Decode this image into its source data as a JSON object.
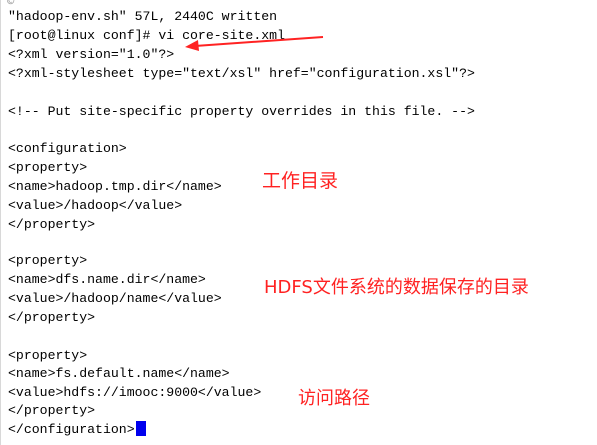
{
  "terminal": {
    "top_mark": "©",
    "lines": [
      "\"hadoop-env.sh\" 57L, 2440C written",
      "[root@linux conf]# vi core-site.xml",
      "<?xml version=\"1.0\"?>",
      "<?xml-stylesheet type=\"text/xsl\" href=\"configuration.xsl\"?>",
      "",
      "<!-- Put site-specific property overrides in this file. -->",
      "",
      "<configuration>",
      "<property>",
      "<name>hadoop.tmp.dir</name>",
      "<value>/hadoop</value>",
      "</property>",
      "",
      "<property>",
      "<name>dfs.name.dir</name>",
      "<value>/hadoop/name</value>",
      "</property>",
      "",
      "<property>",
      "<name>fs.default.name</name>",
      "<value>hdfs://imooc:9000</value>",
      "</property>",
      "</configuration>"
    ]
  },
  "annotations": {
    "working_dir": "工作目录",
    "hdfs_dir": "HDFS文件系统的数据保存的目录",
    "access_path": "访问路径"
  },
  "colors": {
    "annotation": "#ff2222",
    "cursor": "#0000ee"
  }
}
